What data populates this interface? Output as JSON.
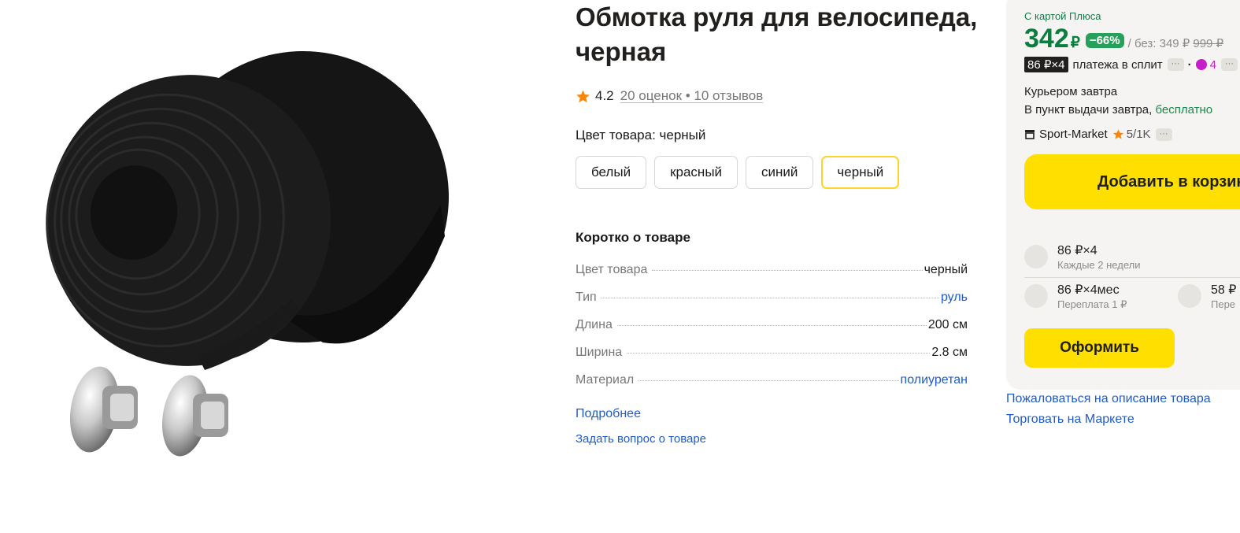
{
  "product": {
    "title": "Обмотка руля для велосипеда, черная",
    "rating": "4.2",
    "reviews": "20 оценок • 10 отзывов",
    "color_label": "Цвет товара:",
    "color_value": "черный",
    "colors": [
      {
        "label": "белый",
        "selected": false
      },
      {
        "label": "красный",
        "selected": false
      },
      {
        "label": "синий",
        "selected": false
      },
      {
        "label": "черный",
        "selected": true
      }
    ]
  },
  "about": {
    "heading": "Коротко о товаре",
    "specs": [
      {
        "name": "Цвет товара",
        "value": "черный",
        "link": false
      },
      {
        "name": "Тип",
        "value": "руль",
        "link": true
      },
      {
        "name": "Длина",
        "value": "200 см",
        "link": false
      },
      {
        "name": "Ширина",
        "value": "2.8 см",
        "link": false
      },
      {
        "name": "Материал",
        "value": "полиуретан",
        "link": true
      }
    ],
    "more_link": "Подробнее",
    "ask_link": "Задать вопрос о товаре"
  },
  "buy_box": {
    "plus_label": "С картой Плюса",
    "price": "342",
    "currency": "₽",
    "discount": "−66%",
    "without_card": "/ без: 349 ₽",
    "old_price": "999 ₽",
    "split_badge": "86 ₽×4",
    "split_text": "платежа в сплит",
    "more_pill": "···",
    "dot": "·",
    "plus_points": "4",
    "delivery_courier": "Курьером завтра",
    "delivery_pickup": "В пункт выдачи завтра,",
    "delivery_free": "бесплатно",
    "seller_name": "Sport-Market",
    "seller_rating": "5/1K",
    "add_to_cart": "Добавить в корзину",
    "installments": [
      {
        "title": "86 ₽×4",
        "sub": "Каждые 2 недели"
      },
      {
        "title": "86 ₽×4мес",
        "sub": "Переплата 1 ₽"
      },
      {
        "title": "58 ₽",
        "sub": "Пере"
      }
    ],
    "checkout": "Оформить"
  },
  "links": {
    "complain": "Пожаловаться на описание товара",
    "sell": "Торговать на Маркете"
  },
  "colors": {
    "accent_yellow": "#fedf00",
    "price_green": "#0a7e3e",
    "link_blue": "#1f5cc7",
    "plus_magenta": "#c41dc9"
  }
}
